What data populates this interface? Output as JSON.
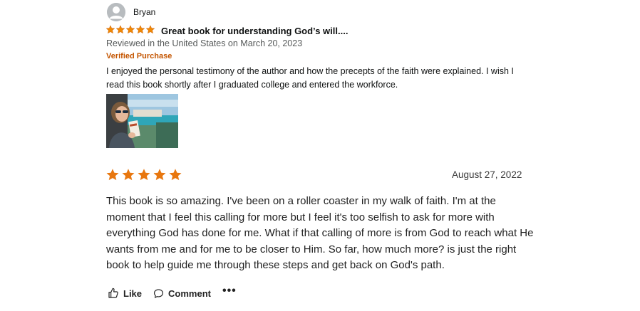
{
  "review1": {
    "reviewer_name": "Bryan",
    "rating": 5,
    "title": "Great book for understanding God’s will....",
    "reviewed_line": "Reviewed in the United States on March 20, 2023",
    "verified": "Verified Purchase",
    "body": "I enjoyed the personal testimony of the author and how the precepts of the faith were explained. I wish I read this book shortly after I graduated college and entered the workforce.",
    "star_color": "#f08804"
  },
  "review2": {
    "rating": 5,
    "date": "August 27, 2022",
    "body": "This book is so amazing. I've been on a roller coaster in my walk of faith. I'm at the moment that I feel this calling for more but I feel it's too selfish to ask for more with everything God has done for me. What if that calling of more is from God to reach what He wants from me and for me to be closer to Him. So far, how much more? is just the right book to help guide me through these steps and get back on God's path.",
    "star_color": "#e8770f"
  },
  "actions": {
    "like_label": "Like",
    "comment_label": "Comment",
    "more_label": "•••"
  }
}
